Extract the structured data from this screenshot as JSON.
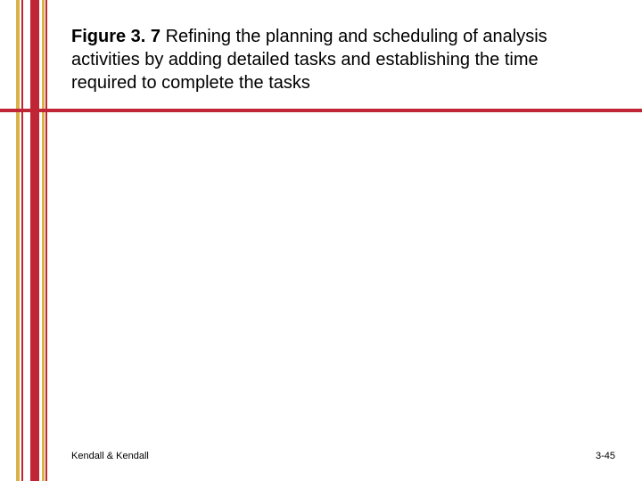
{
  "heading": {
    "bold": "Figure 3. 7",
    "rest": " Refining the planning and scheduling of analysis activities by adding detailed tasks and establishing the time required to complete the tasks"
  },
  "footer": {
    "left": "Kendall & Kendall",
    "right": "3-45"
  }
}
